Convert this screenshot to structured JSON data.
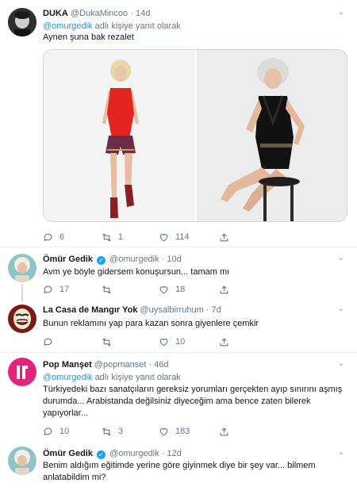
{
  "tweets": [
    {
      "name": "DUKA",
      "handle": "@DukaMincoo",
      "time": "14d",
      "reply_mention": "@omurgedik",
      "reply_suffix": "adlı kişiye yanıt olarak",
      "text": "Aynen şuna bak rezalet",
      "replies": "6",
      "retweets": "1",
      "likes": "114"
    },
    {
      "name": "Ömür Gedik",
      "handle": "@omurgedik",
      "time": "10d",
      "verified": true,
      "text": "Avm ye böyle gidersem konuşursun... tamam mı",
      "replies": "17",
      "retweets": "",
      "likes": "18"
    },
    {
      "name": "La Casa de Mangır Yok",
      "handle": "@uysalbirruhum",
      "time": "7d",
      "text": "Bunun reklamını yap para kazan sonra giyenlere çemkir",
      "replies": "",
      "retweets": "",
      "likes": "10"
    },
    {
      "name": "Pop Manşet",
      "handle": "@popmanset",
      "time": "46d",
      "reply_mention": "@omurgedik",
      "reply_suffix": "adlı kişiye yanıt olarak",
      "text": "Türkiyedeki bazı sanatçıların gereksiz yorumları gerçekten ayıp sınırını aşmış durumda... Arabistanda değilsiniz diyeceğim ama bence zaten bilerek yapıyorlar...",
      "replies": "10",
      "retweets": "3",
      "likes": "183"
    },
    {
      "name": "Ömür Gedik",
      "handle": "@omurgedik",
      "time": "12d",
      "verified": true,
      "text": "Benim aldığım eğitimde yerine göre giyinmek diye bir şey var... bilmem anlatabildim mi?"
    }
  ],
  "dot": "·",
  "icons": {
    "reply": "speech-bubble-icon",
    "retweet": "retweet-arrows-icon",
    "like": "heart-icon",
    "share": "share-upload-icon",
    "more": "chevron-down-icon",
    "verified": "verified-badge-icon"
  },
  "colors": {
    "link": "#1b95e0",
    "verified": "#1da1f2",
    "muted": "#657786",
    "popmanset_avatar": "#e0257a"
  }
}
